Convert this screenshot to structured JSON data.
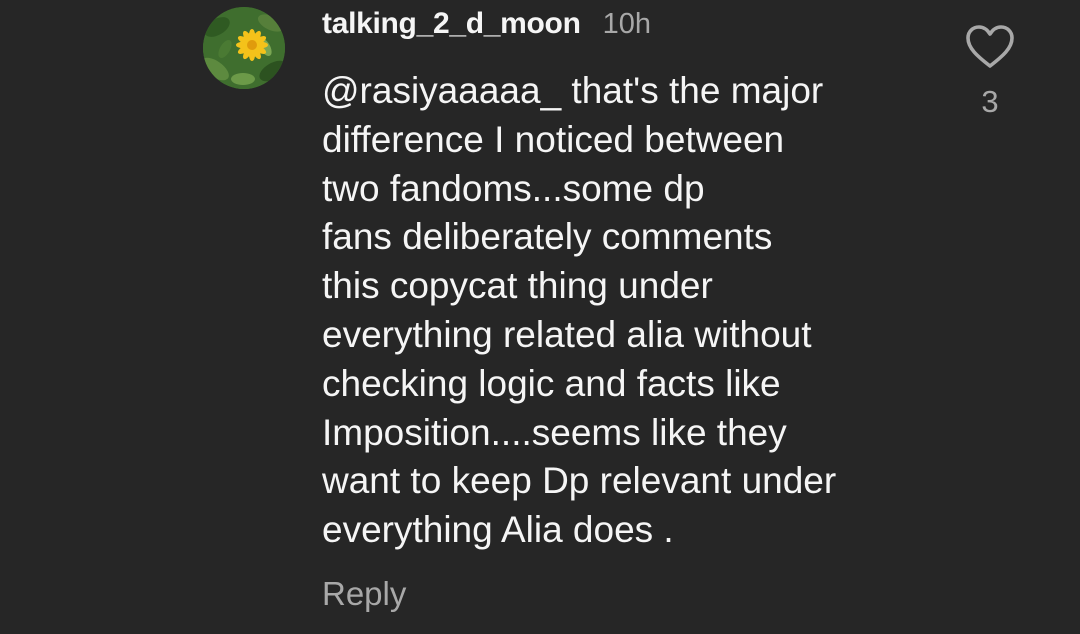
{
  "comment": {
    "username": "talking_2_d_moon",
    "timestamp": "10h",
    "mention": "@rasiyaaaaa_",
    "lines": [
      " that's the major",
      "difference I noticed between",
      "two fandoms...some dp",
      "fans deliberately comments",
      "this copycat thing under",
      "everything related alia without",
      "checking logic and facts like",
      "Imposition....seems like they",
      "want to keep Dp relevant under",
      "everything Alia does ."
    ],
    "reply_label": "Reply",
    "like_count": "3",
    "icons": {
      "like": "heart-outline-icon"
    },
    "colors": {
      "background": "#262626",
      "primary_text": "#f5f5f5",
      "secondary_text": "#a8a8a8"
    }
  }
}
